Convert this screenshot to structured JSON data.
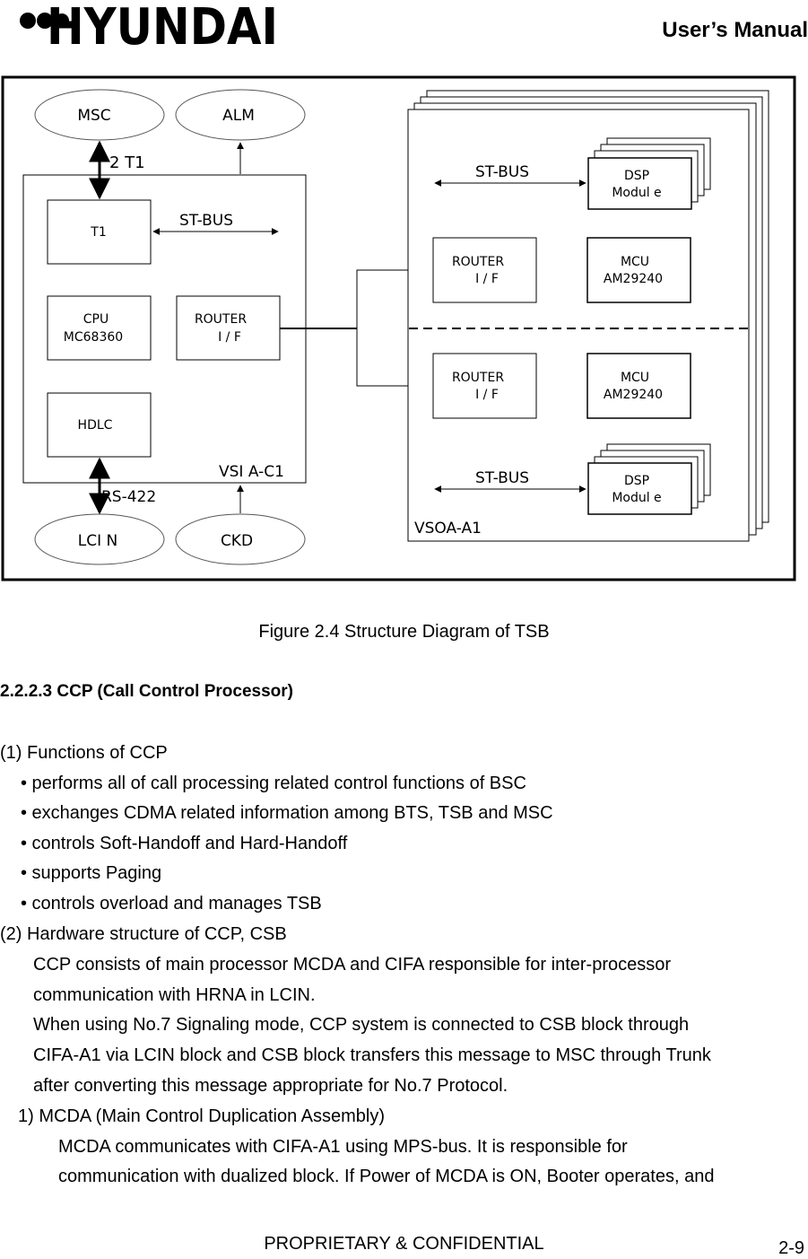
{
  "header": {
    "logo_text": "HYUNDAI",
    "title": "User’s Manual"
  },
  "diagram": {
    "external_nodes": {
      "msc": "MSC",
      "alm": "ALM",
      "lcin": "LCI N",
      "ckd": "CKD"
    },
    "links": {
      "msc_t1": "2 T1",
      "rs422": "RS-422",
      "st_bus_left": "ST-BUS",
      "st_bus_right_top": "ST-BUS",
      "st_bus_right_bottom": "ST-BUS"
    },
    "vsia": {
      "label": "VSI A-C1",
      "t1": "T1",
      "cpu_line1": "CPU",
      "cpu_line2": "MC68360",
      "router_line1": "ROUTER",
      "router_line2": "I / F",
      "hdlc": "HDLC"
    },
    "vsoa": {
      "label": "VSOA-A1",
      "dsp_top_line1": "DSP",
      "dsp_top_line2": "Modul e",
      "router_top_line1": "ROUTER",
      "router_top_line2": "I / F",
      "mcu_top_line1": "MCU",
      "mcu_top_line2": "AM29240",
      "router_bottom_line1": "ROUTER",
      "router_bottom_line2": "I / F",
      "mcu_bottom_line1": "MCU",
      "mcu_bottom_line2": "AM29240",
      "dsp_bottom_line1": "DSP",
      "dsp_bottom_line2": "Modul e"
    }
  },
  "caption": "Figure 2.4 Structure Diagram of TSB",
  "section": {
    "heading": "2.2.2.3  CCP (Call Control Processor)",
    "functions_title": "(1) Functions of CCP",
    "functions": [
      "• performs all of call processing related control functions of BSC",
      "• exchanges CDMA related information among BTS, TSB and MSC",
      "• controls Soft-Handoff and Hard-Handoff",
      "• supports Paging",
      "• controls overload and manages TSB"
    ],
    "hardware_title": "(2) Hardware structure of CCP, CSB",
    "hardware_lines": [
      "CCP consists of main processor MCDA and CIFA responsible for inter-processor",
      "communication with HRNA in LCIN.",
      "When using No.7 Signaling mode, CCP system is connected to CSB block through",
      "CIFA-A1 via LCIN block and CSB block transfers this message to MSC through Trunk",
      "after converting this message appropriate for No.7 Protocol."
    ],
    "mcda_title": "1) MCDA (Main Control Duplication Assembly)",
    "mcda_lines": [
      "MCDA communicates with CIFA-A1 using MPS-bus. It is responsible for",
      "communication with dualized block. If Power of MCDA is ON, Booter operates, and"
    ]
  },
  "footer": {
    "confidential": "PROPRIETARY & CONFIDENTIAL",
    "page_number": "2-9"
  }
}
